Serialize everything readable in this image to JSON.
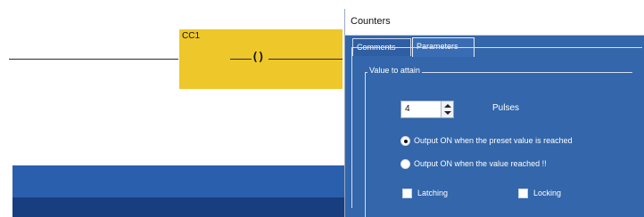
{
  "ladder": {
    "coil_name": "CC1",
    "coil_symbol": "()"
  },
  "dialog": {
    "title": "Counters",
    "tabs": [
      {
        "label": "Comments",
        "active": false
      },
      {
        "label": "Parameters",
        "active": true
      }
    ],
    "group_label": "Value to attain",
    "preset_value": "4",
    "unit_label": "Pulses",
    "options": [
      {
        "label": "Output ON when the preset value is reached",
        "selected": true
      },
      {
        "label": "Output ON when the value reached !!",
        "selected": false
      }
    ],
    "checkboxes": [
      {
        "label": "Latching",
        "checked": false
      },
      {
        "label": "Locking",
        "checked": false
      }
    ]
  },
  "colors": {
    "coil_fill": "#eec72a",
    "dialog_bg": "#3366aa",
    "band_blue": "#2a5fae",
    "band_dark": "#183e80"
  }
}
